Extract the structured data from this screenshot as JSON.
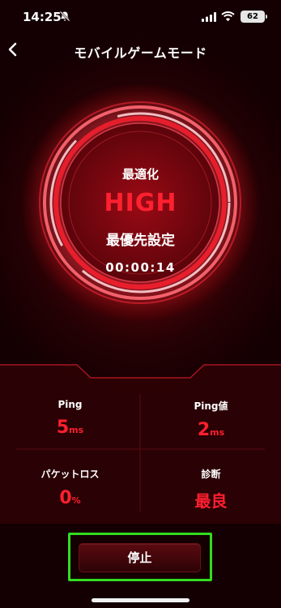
{
  "status_bar": {
    "time": "14:25",
    "battery": "62"
  },
  "header": {
    "title": "モバイルゲームモード"
  },
  "gauge": {
    "optimization_label": "最適化",
    "level": "HIGH",
    "priority_label": "最優先設定",
    "elapsed": "00:00:14"
  },
  "stats": {
    "ping": {
      "label": "Ping",
      "value": "5",
      "unit": "ms"
    },
    "ping_value": {
      "label": "Ping値",
      "value": "2",
      "unit": "ms"
    },
    "packet_loss": {
      "label": "パケットロス",
      "value": "0",
      "unit": "%"
    },
    "diagnosis": {
      "label": "診断",
      "value": "最良"
    }
  },
  "stop_button": {
    "label": "停止"
  },
  "colors": {
    "accent": "#ff1f2f",
    "highlight_border": "#33dd22",
    "background": "#240104"
  }
}
